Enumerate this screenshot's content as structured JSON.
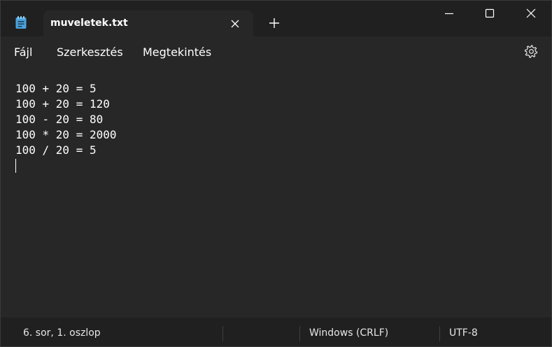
{
  "tab": {
    "title": "muveletek.txt"
  },
  "menu": {
    "file": "Fájl",
    "edit": "Szerkesztés",
    "view": "Megtekintés"
  },
  "editor": {
    "lines": [
      "100 + 20 = 5",
      "100 + 20 = 120",
      "100 - 20 = 80",
      "100 * 20 = 2000",
      "100 / 20 = 5"
    ]
  },
  "status": {
    "position": "6. sor, 1. oszlop",
    "line_ending": "Windows (CRLF)",
    "encoding": "UTF-8"
  },
  "icons": {
    "app": "notepad-icon",
    "tab_close": "close-icon",
    "new_tab": "plus-icon",
    "minimize": "minimize-icon",
    "maximize": "maximize-icon",
    "close": "close-icon",
    "settings": "gear-icon"
  },
  "colors": {
    "titlebar": "#202020",
    "surface": "#272727",
    "app_icon": "#4ca3dd"
  }
}
